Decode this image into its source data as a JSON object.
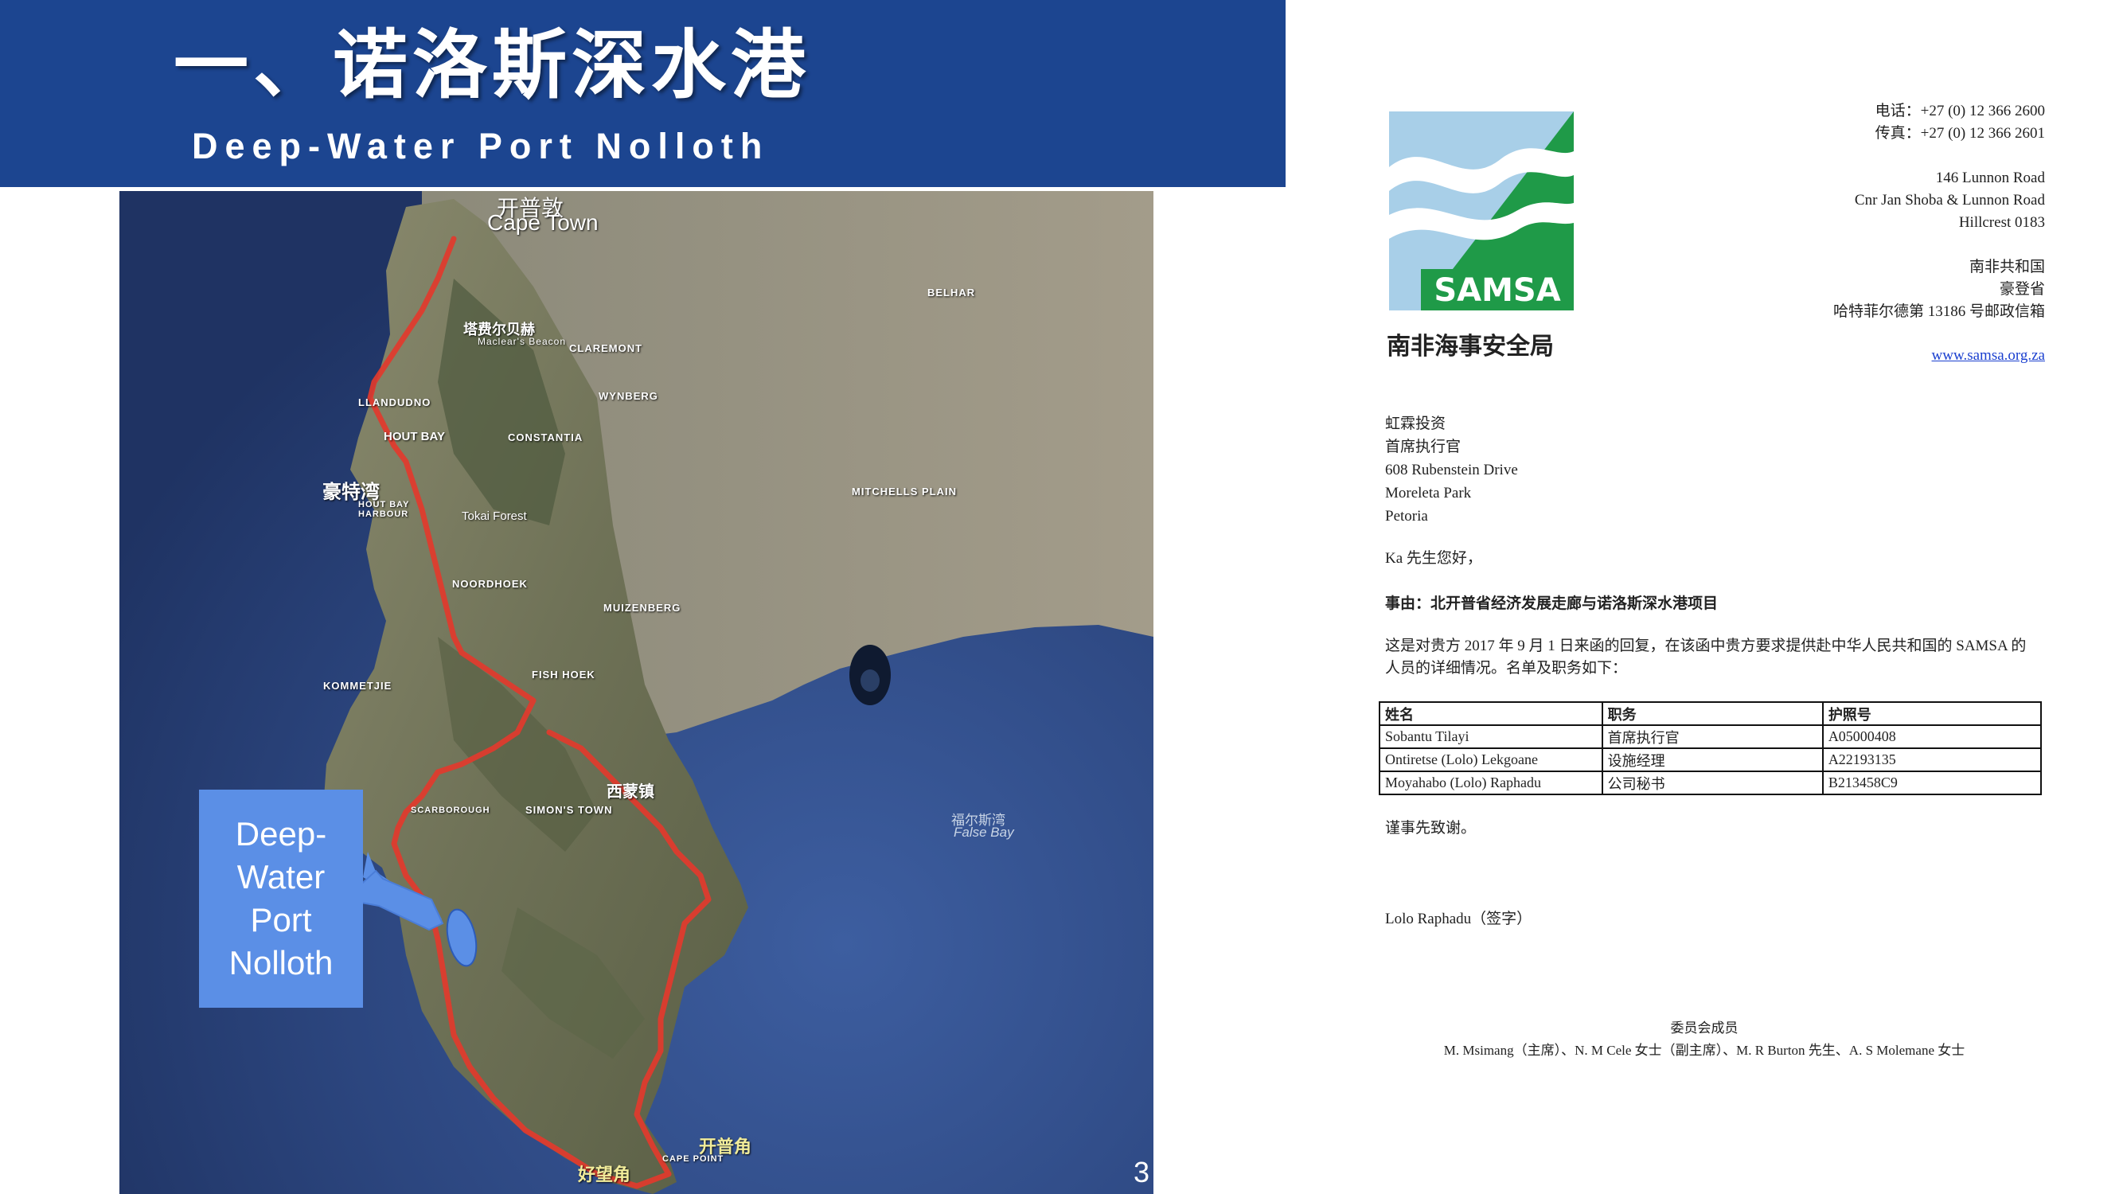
{
  "slide": {
    "title_cn": "一、诺洛斯深水港",
    "title_en": "Deep-Water Port Nolloth",
    "page_number": "3",
    "callout": "Deep-Water Port Nolloth",
    "map_labels": {
      "cape_town_cn": "开普敦",
      "cape_town": "Cape Town",
      "table_mountain_cn": "塔费尔贝赫",
      "maclears_beacon": "Maclear's Beacon",
      "hout_bay_cn": "豪特湾",
      "hout_bay": "HOUT BAY",
      "hout_bay_harbour": "HOUT BAY HARBOUR",
      "llandudno": "LLANDUDNO",
      "constantia": "CONSTANTIA",
      "tokai_forest": "Tokai Forest",
      "noordhoek": "NOORDHOEK",
      "kommetjie": "KOMMETJIE",
      "muizenberg": "MUIZENBERG",
      "fish_hoek": "FISH HOEK",
      "simons_town_cn": "西蒙镇",
      "simons_town": "SIMON'S TOWN",
      "scarborough": "SCARBOROUGH",
      "claremont": "CLAREMONT",
      "wynberg": "WYNBERG",
      "mitchells_plain": "MITCHELLS PLAIN",
      "belhar": "BELHAR",
      "false_bay_cn": "福尔斯湾",
      "false_bay": "False Bay",
      "cape_point_cn": "开普角",
      "cape_point": "CAPE POINT",
      "good_hope_cn": "好望角"
    }
  },
  "letter": {
    "logo_text": "SAMSA",
    "agency_name": "南非海事安全局",
    "tel": "电话：+27 (0) 12 366 2600",
    "fax": "传真：+27 (0) 12 366 2601",
    "street1": "146 Lunnon Road",
    "street2": "Cnr Jan Shoba & Lunnon Road",
    "street3": "Hillcrest 0183",
    "country": "南非共和国",
    "province": "豪登省",
    "pobox": "哈特菲尔德第 13186 号邮政信箱",
    "website": "www.samsa.org.za",
    "recipient_lines": [
      "虹霖投资",
      "首席执行官",
      "608 Rubenstein Drive",
      "Moreleta Park",
      "Petoria"
    ],
    "salutation": "Ka 先生您好，",
    "subject": "事由：北开普省经济发展走廊与诺洛斯深水港项目",
    "body": "这是对贵方 2017 年 9 月 1 日来函的回复，在该函中贵方要求提供赴中华人民共和国的 SAMSA 的人员的详细情况。名单及职务如下：",
    "table_headers": [
      "姓名",
      "职务",
      "护照号"
    ],
    "table_rows": [
      [
        "Sobantu Tilayi",
        "首席执行官",
        "A05000408"
      ],
      [
        "Ontiretse (Lolo) Lekgoane",
        "设施经理",
        "A22193135"
      ],
      [
        "Moyahabo (Lolo) Raphadu",
        "公司秘书",
        "B213458C9"
      ]
    ],
    "thanks": "谨事先致谢。",
    "signature": "Lolo Raphadu（签字）",
    "board_title": "委员会成员",
    "board_members": "M. Msimang（主席）、N. M Cele 女士（副主席）、M. R Burton 先生、A. S Molemane 女士"
  },
  "colors": {
    "header_blue": "#1c4590",
    "callout_blue": "#5b8fe6",
    "route_red": "#e23a2c",
    "logo_green": "#1f9a48",
    "link_blue": "#1a3fcf"
  }
}
